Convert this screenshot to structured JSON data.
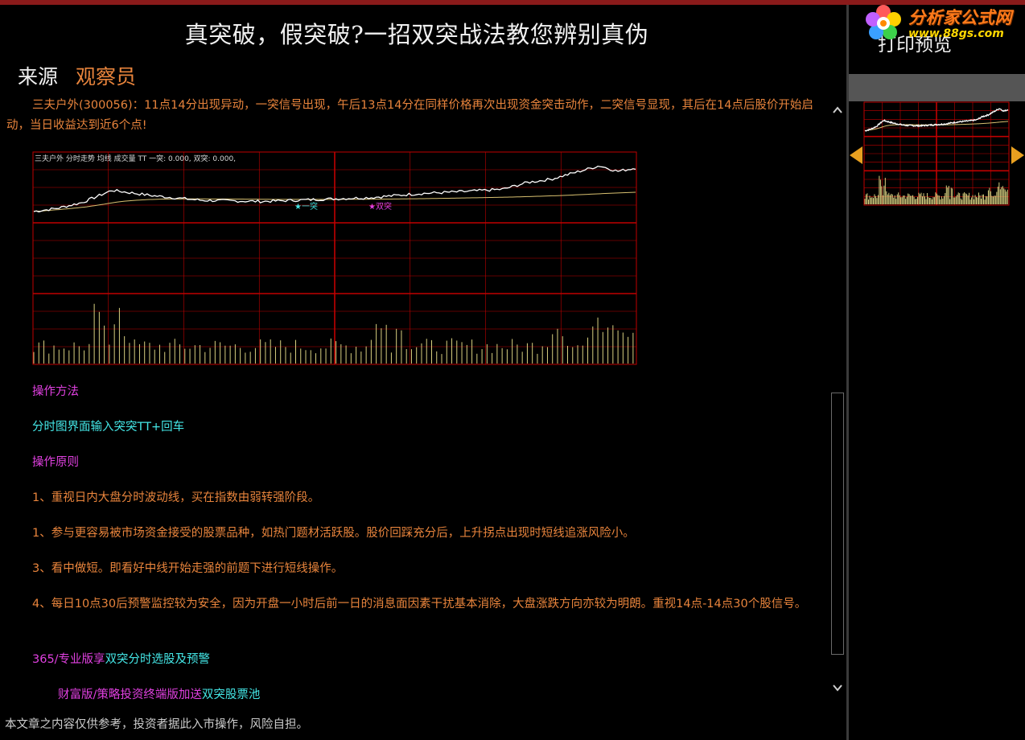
{
  "article": {
    "title": "真突破，假突破?一招双突战法教您辨别真伪",
    "source_label": "来源",
    "source_author": "观察员",
    "intro": "三夫户外(300056)：11点14分出现异动，一突信号出现，午后13点14分在同样价格再次出现资金突击动作，二突信号显现，其后在14点后股价开始启动，当日收益达到近6个点!",
    "method_title": "操作方法",
    "method_text": "分时图界面输入突突TT+回车",
    "principle_title": "操作原则",
    "principles": [
      "1、重视日内大盘分时波动线，买在指数由弱转强阶段。",
      "1、参与更容易被市场资金接受的股票品种，如热门题材活跃股。股价回踩充分后，上升拐点出现时短线追涨风险小。",
      "3、看中做短。即看好中线开始走强的前题下进行短线操作。",
      "4、每日10点30后预警监控较为安全，因为开盘一小时后前一日的消息面因素干扰基本消除，大盘涨跌方向亦较为明朗。重视14点-14点30个股信号。"
    ],
    "promo1_a": "365/专业版享",
    "promo1_b": "双突分时选股及预警",
    "promo2_a": "财富版/策略投资终端版加送",
    "promo2_b": "双突股票池",
    "disclaimer": "本文章之内容仅供参考，投资者据此入市操作，风险自担。"
  },
  "chart_header": "三夫户外 分时走势  均线 成交量 TT 一突: 0.000, 双突: 0.000,",
  "chart_labels": {
    "signal1": "一突",
    "signal2": "双突"
  },
  "sidebar": {
    "title": "打印预览",
    "logo_cn": "分析家公式网",
    "logo_url": "www.88gs.com"
  },
  "scrollbar": {
    "up_icon": "chevron-up-icon",
    "down_icon": "chevron-down-icon"
  },
  "colors": {
    "grid": "#c00000",
    "price": "#ffffff",
    "avg": "#d8c070",
    "volume": "#d8d080",
    "signal1": "#44e6e6",
    "signal2": "#e040e0"
  }
}
